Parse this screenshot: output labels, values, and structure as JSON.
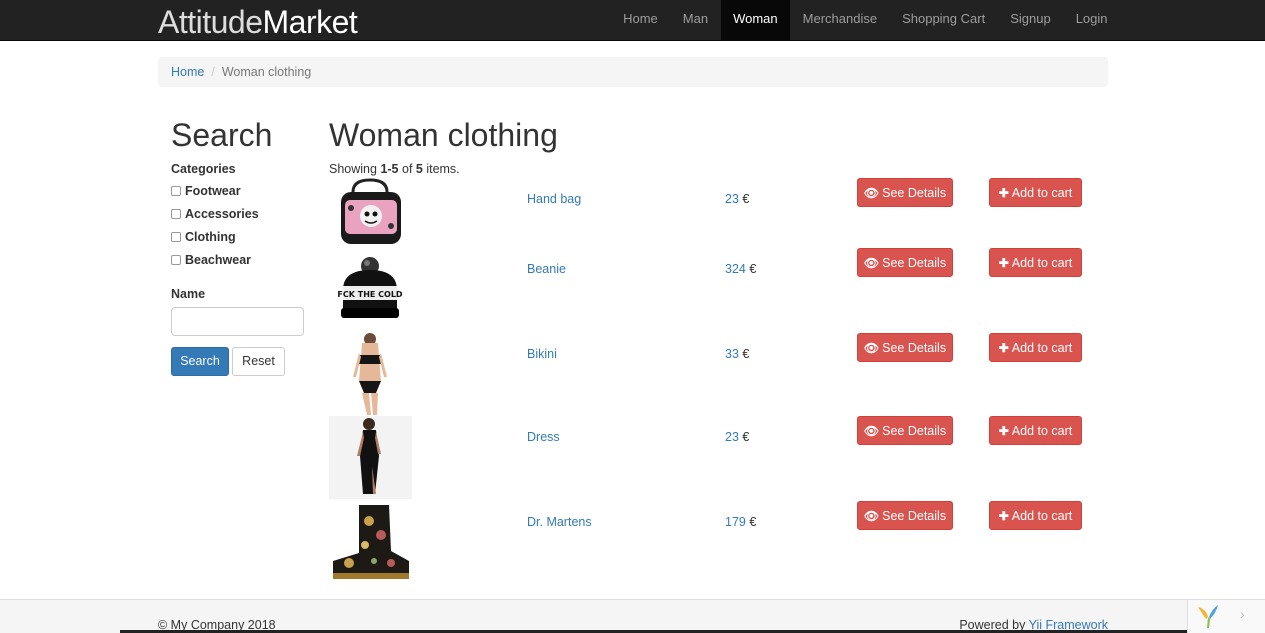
{
  "nav": {
    "brand_main": "Attitude",
    "brand_second": "Market",
    "items": [
      "Home",
      "Man",
      "Woman",
      "Merchandise",
      "Shopping Cart",
      "Signup",
      "Login"
    ],
    "active": "Woman"
  },
  "breadcrumb": {
    "home": "Home",
    "current": "Woman clothing"
  },
  "sidebar": {
    "title": "Search",
    "categories_label": "Categories",
    "categories": [
      "Footwear",
      "Accessories",
      "Clothing",
      "Beachwear"
    ],
    "name_label": "Name",
    "name_value": "",
    "search_button": "Search",
    "reset_button": "Reset"
  },
  "main": {
    "title": "Woman clothing",
    "summary_prefix": "Showing ",
    "summary_range": "1-5",
    "summary_of": " of ",
    "summary_total": "5",
    "summary_suffix": " items.",
    "see_details_label": "See Details",
    "add_to_cart_label": "Add to cart",
    "currency": "€",
    "products": [
      {
        "name": "Hand bag",
        "price": "23"
      },
      {
        "name": "Beanie",
        "price": "324"
      },
      {
        "name": "Bikini",
        "price": "33"
      },
      {
        "name": "Dress",
        "price": "23"
      },
      {
        "name": "Dr. Martens",
        "price": "179"
      }
    ]
  },
  "footer": {
    "copyright": "© My Company 2018",
    "powered_prefix": "Powered by ",
    "powered_link": "Yii Framework"
  },
  "colors": {
    "navbar": "#222222",
    "link": "#337ab7",
    "danger": "#d9534f",
    "primary": "#337ab7"
  }
}
